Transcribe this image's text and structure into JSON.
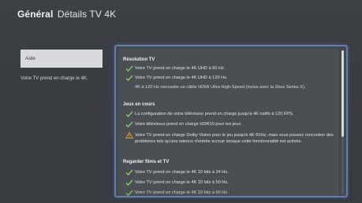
{
  "header": {
    "section": "Général",
    "page_title": "Détails TV 4K"
  },
  "sidebar": {
    "help_label": "Aide",
    "description": "Votre TV prend en charge le 4K."
  },
  "colors": {
    "check": "#7ed957",
    "warning": "#f0a030",
    "focus_border": "#5d7fb1"
  },
  "sections": [
    {
      "title": "Résolution TV",
      "items": [
        {
          "icon": "check-icon",
          "text": "Votre TV prend en charge le 4K UHD à 60 Hz."
        },
        {
          "icon": "check-icon",
          "text": "Votre TV prend en charge le 4K UHD à 120 Hz."
        }
      ],
      "note": "4K à 120 Hz nécessite un câble HDMI Ultra High-Speed (inclus avec la Xbox Series X)."
    },
    {
      "title": "Jeux en cours",
      "items": [
        {
          "icon": "check-icon",
          "text": "La configuration de votre téléviseur prend en charge jusqu'à 4K natifs à 120 FPS."
        },
        {
          "icon": "check-icon",
          "text": "Votre téléviseur prend en charge HDR10 pour les jeux."
        },
        {
          "icon": "warning-icon",
          "text": "Votre TV prend en charge Dolby Vision pour le jeu jusqu'à 4K 60Hz, mais vous pouvez rencontrer des problèmes tels qu'une latence d'entrée accrue lorsque cette fonctionnalité est activée."
        }
      ]
    },
    {
      "title": "Regarder films et TV",
      "items": [
        {
          "icon": "check-icon",
          "text": "Votre TV prend en charge le 4K 10 bits à 24 Hz."
        },
        {
          "icon": "check-icon",
          "text": "Votre TV prend en charge le 4K 10 bits à 50 Hz."
        },
        {
          "icon": "check-icon",
          "text": "Votre TV prend en charge le 4K 10 bits à 60 Hz."
        }
      ]
    }
  ]
}
